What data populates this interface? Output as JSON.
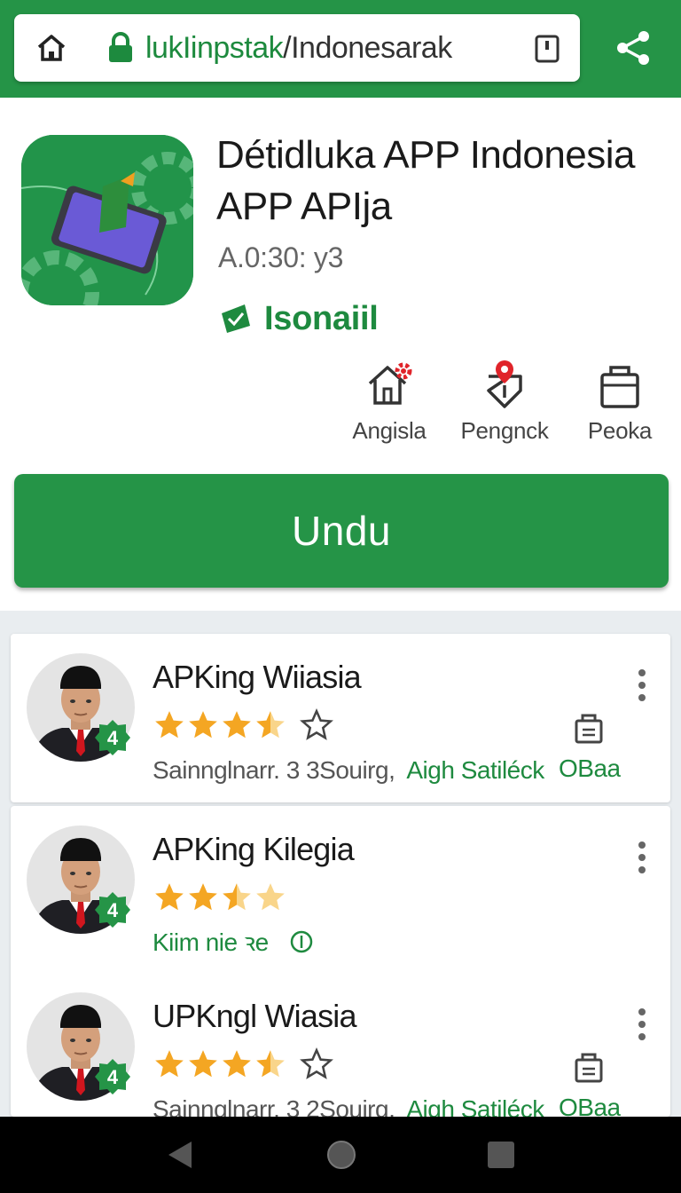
{
  "browser": {
    "url_domain": "lukIinpstak",
    "url_path": "/Indonesarak"
  },
  "app": {
    "title": "Détidluka APP Indonesia APP APIja",
    "version": "A.0:30: y3",
    "developer": "Isonaiil",
    "actions": [
      {
        "label": "Angisla",
        "icon": "home-gear-icon"
      },
      {
        "label": "Pengnck",
        "icon": "location-pin-icon"
      },
      {
        "label": "Peoka",
        "icon": "shopping-bag-icon"
      }
    ],
    "install_label": "Undu",
    "colors": {
      "brand_green": "#259447",
      "star": "#f4a623"
    }
  },
  "list": [
    {
      "title": "APKing Wiiasia",
      "rating": 3.5,
      "badge": "4",
      "meta_gray": "Sainnglnarr. 3 3Souirg,",
      "meta_green": "Aigh  Satiléck",
      "action": "OBaa"
    },
    {
      "title": "APKing Kilegia",
      "rating": 2.5,
      "badge": "4",
      "meta_green": "Kiim nie ꝛe"
    },
    {
      "title": "UPKngl Wiasia",
      "rating": 3.5,
      "badge": "4",
      "meta_gray": "Sainnglnarr. 3 2Souirg,",
      "meta_green": "Aigh  Satiléck",
      "action": "OBaa"
    }
  ]
}
